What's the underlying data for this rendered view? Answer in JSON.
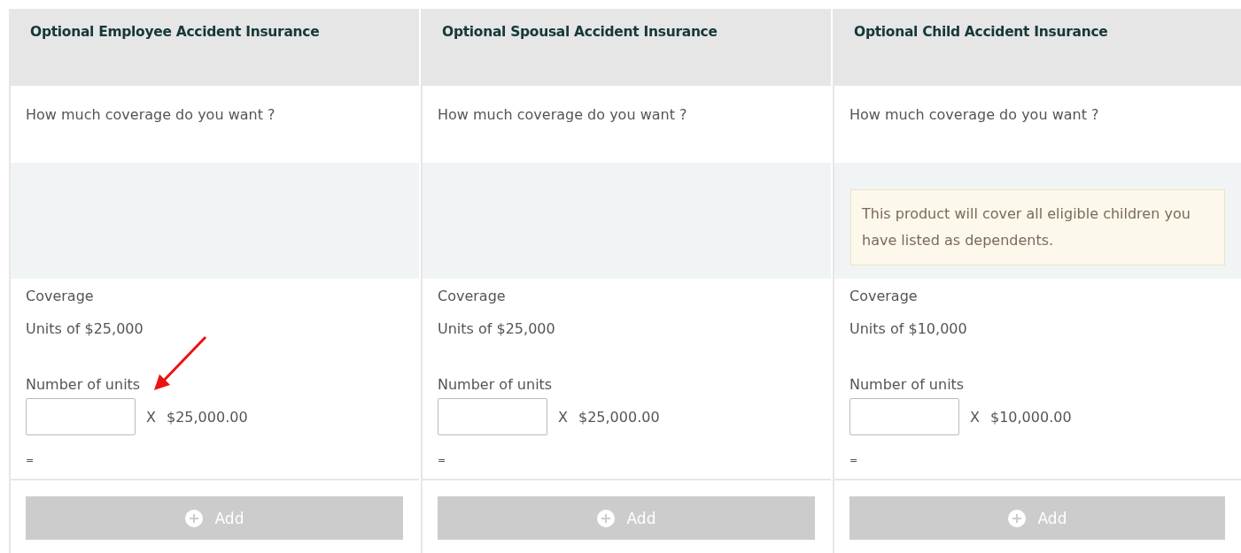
{
  "columns": [
    {
      "title": "Optional Employee Accident Insurance",
      "question": "How much coverage do you want ?",
      "coverage_label": "Coverage",
      "units_label": "Units of $25,000",
      "number_label": "Number of units",
      "multiplier": "X",
      "unit_price": "$25,000.00",
      "equals": "=",
      "add_button": {
        "label": "Add",
        "disabled": true
      },
      "annotated": true
    },
    {
      "title": "Optional Spousal Accident Insurance",
      "question": "How much coverage do you want ?",
      "coverage_label": "Coverage",
      "units_label": "Units of $25,000",
      "number_label": "Number of units",
      "multiplier": "X",
      "unit_price": "$25,000.00",
      "equals": "=",
      "add_button": {
        "label": "Add",
        "disabled": true
      },
      "annotated": false
    },
    {
      "title": "Optional Child Accident Insurance",
      "question": "How much coverage do you want ?",
      "notice": "This product will cover all eligible children you have listed as dependents.",
      "coverage_label": "Coverage",
      "units_label": "Units of $10,000",
      "number_label": "Number of units",
      "multiplier": "X",
      "unit_price": "$10,000.00",
      "equals": "=",
      "add_button": {
        "label": "Add",
        "disabled": true
      },
      "annotated": false
    }
  ]
}
